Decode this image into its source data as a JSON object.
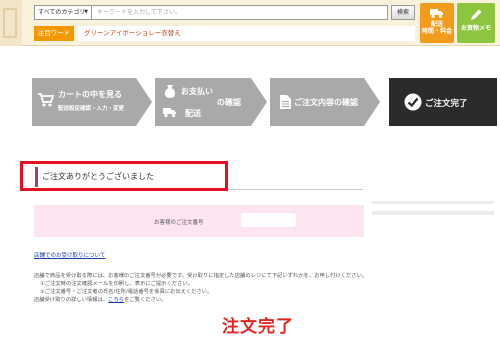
{
  "header": {
    "category_select": "すべてのカテゴリ",
    "search_placeholder": "キーワードを入力して下さい。",
    "search_button": "検索",
    "hot_tag": "注目ワード",
    "hot_text": "グリーンアイボーショレー衣替え",
    "shipping_button": [
      "配送",
      "時間・料金"
    ],
    "memo_button": "お買物メモ"
  },
  "steps": [
    {
      "lines": [
        "カートの中を見る",
        "配送設定確認・入力・変更"
      ],
      "icon": "cart-icon",
      "active": false
    },
    {
      "lines": [
        "お支払い",
        "配送",
        "の確認"
      ],
      "icon": "money-bag-icon",
      "active": false
    },
    {
      "lines": [
        "ご注文内容の確認"
      ],
      "icon": "document-icon",
      "active": false
    },
    {
      "lines": [
        "ご注文完了"
      ],
      "icon": "check-circle-icon",
      "active": true
    }
  ],
  "message": {
    "thanks": "ご注文ありがとうございました",
    "order_number_label": "お客様のご注文番号"
  },
  "body": {
    "pickup_link": "店舗でのお受け取りについて",
    "lines": [
      "店舗で商品を受け取る際には、お客様のご注文番号が必要です。受け取りに指定した店舗のレジにて下記いずれかを、お申し付けください。",
      "①ご注文時の注文確認メールを印刷し、表示にご提示ください。",
      "②ご注文番号・ご注文者の氏名/住所/電話番号を係員にお伝えください。"
    ],
    "last_prefix": "店舗受け取りの詳しい情報は、",
    "last_link": "こちら",
    "last_suffix": "をご覧ください。"
  },
  "annotation": "注文完了",
  "colors": {
    "step_inactive": "#a9a9a9",
    "step_active": "#2b2b2b",
    "highlight_border": "#e4101f",
    "annotation": "#e52620",
    "order_box": "#fce4f0",
    "hot_tag": "#f39800",
    "shipping_button": "#f39b1a",
    "memo_button": "#8cc63f"
  }
}
